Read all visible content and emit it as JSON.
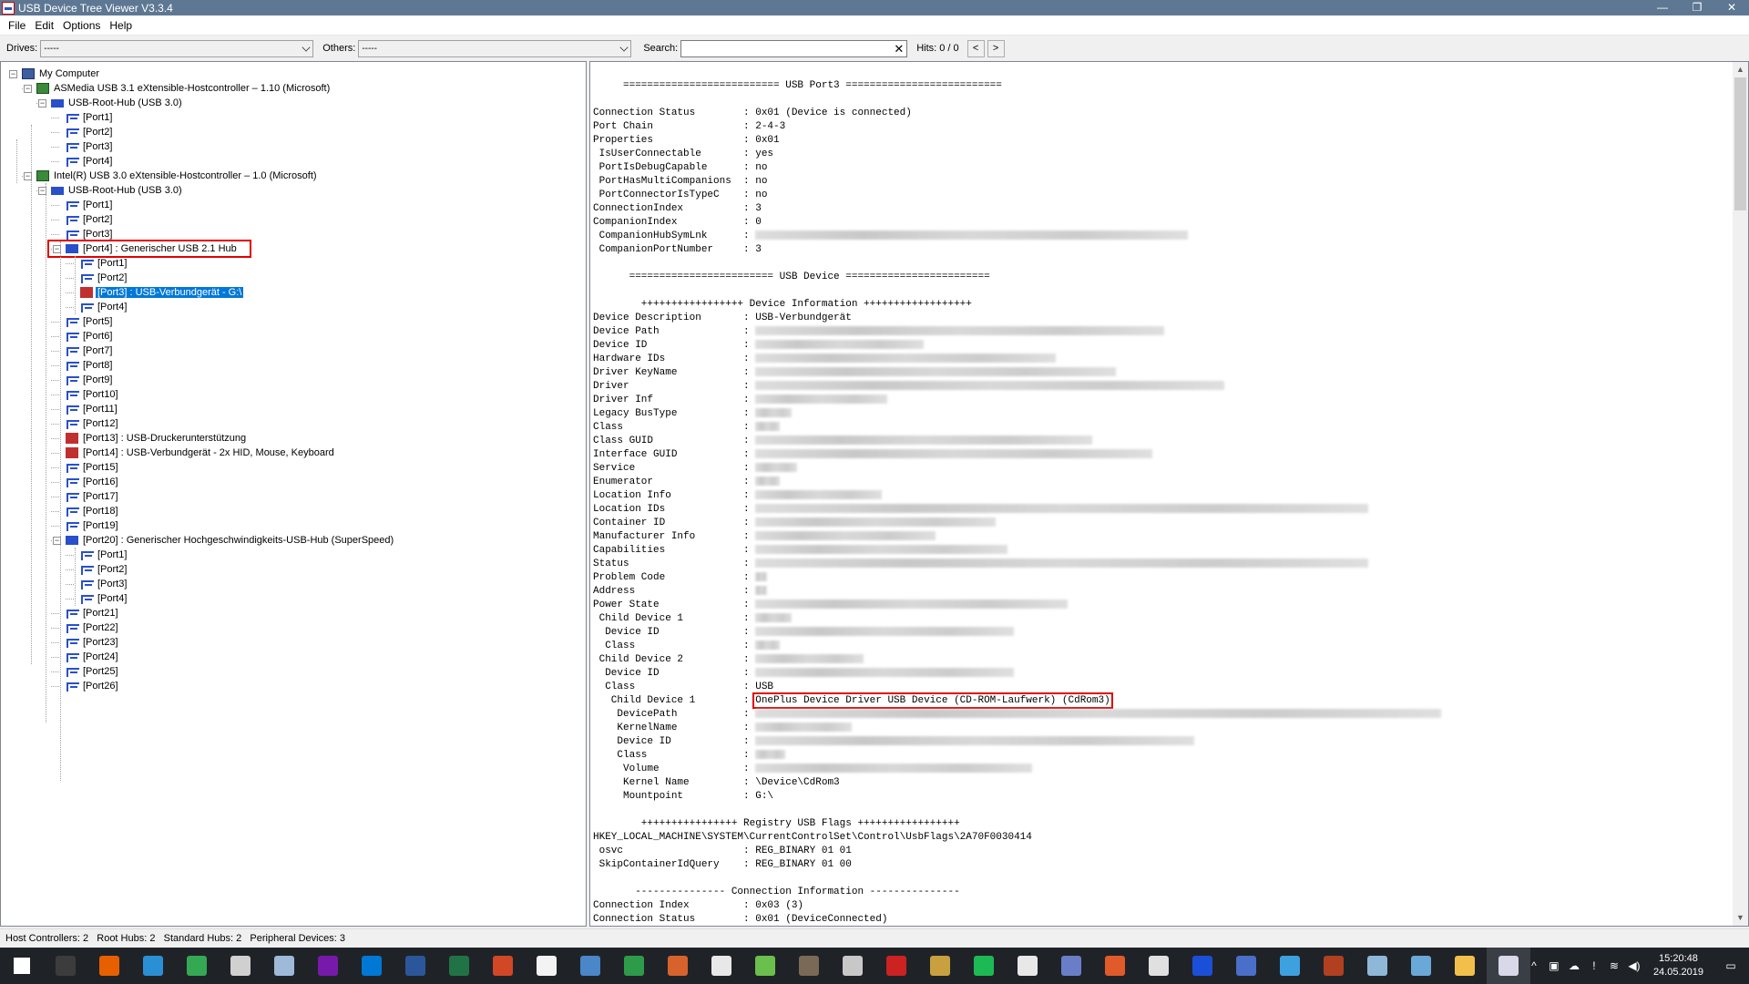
{
  "window": {
    "title": "USB Device Tree Viewer V3.3.4",
    "minimize": "—",
    "restore": "❐",
    "close": "✕"
  },
  "menu": [
    "File",
    "Edit",
    "Options",
    "Help"
  ],
  "toolbar": {
    "drives_label": "Drives:",
    "drives_value": "-----",
    "others_label": "Others:",
    "others_value": "-----",
    "search_label": "Search:",
    "search_value": "",
    "search_clear": "✕",
    "hits_label": "Hits:",
    "hits_value": "0 / 0",
    "prev": "<",
    "next": ">"
  },
  "tree": [
    {
      "label": "My Computer",
      "level": 0,
      "icon": "pc-icon",
      "expander": "−"
    },
    {
      "label": "ASMedia USB 3.1 eXtensible-Hostcontroller – 1.10 (Microsoft)",
      "level": 1,
      "icon": "controller-icon",
      "expander": "−"
    },
    {
      "label": "USB-Root-Hub (USB 3.0)",
      "level": 2,
      "icon": "root-hub-icon",
      "expander": "−"
    },
    {
      "label": "[Port1]",
      "level": 3,
      "icon": "port-icon"
    },
    {
      "label": "[Port2]",
      "level": 3,
      "icon": "port-icon"
    },
    {
      "label": "[Port3]",
      "level": 3,
      "icon": "port-icon"
    },
    {
      "label": "[Port4]",
      "level": 3,
      "icon": "port-icon"
    },
    {
      "label": "Intel(R) USB 3.0 eXtensible-Hostcontroller – 1.0 (Microsoft)",
      "level": 1,
      "icon": "controller-icon",
      "expander": "−"
    },
    {
      "label": "USB-Root-Hub (USB 3.0)",
      "level": 2,
      "icon": "root-hub-icon",
      "expander": "−"
    },
    {
      "label": "[Port1]",
      "level": 3,
      "icon": "port-icon"
    },
    {
      "label": "[Port2]",
      "level": 3,
      "icon": "port-icon"
    },
    {
      "label": "[Port3]",
      "level": 3,
      "icon": "port-icon"
    },
    {
      "label": "[Port4] : Generischer USB 2.1 Hub",
      "level": 3,
      "icon": "hub-icon",
      "expander": "−",
      "boxed": true
    },
    {
      "label": "[Port1]",
      "level": 4,
      "icon": "port-icon"
    },
    {
      "label": "[Port2]",
      "level": 4,
      "icon": "port-icon"
    },
    {
      "label": "[Port3] : USB-Verbundgerät - G:\\",
      "level": 4,
      "icon": "device-icon",
      "selected": true
    },
    {
      "label": "[Port4]",
      "level": 4,
      "icon": "port-icon"
    },
    {
      "label": "[Port5]",
      "level": 3,
      "icon": "port-icon"
    },
    {
      "label": "[Port6]",
      "level": 3,
      "icon": "port-icon"
    },
    {
      "label": "[Port7]",
      "level": 3,
      "icon": "port-icon"
    },
    {
      "label": "[Port8]",
      "level": 3,
      "icon": "port-icon"
    },
    {
      "label": "[Port9]",
      "level": 3,
      "icon": "port-icon"
    },
    {
      "label": "[Port10]",
      "level": 3,
      "icon": "port-icon"
    },
    {
      "label": "[Port11]",
      "level": 3,
      "icon": "port-icon"
    },
    {
      "label": "[Port12]",
      "level": 3,
      "icon": "port-icon"
    },
    {
      "label": "[Port13] : USB-Druckerunterstützung",
      "level": 3,
      "icon": "device-icon"
    },
    {
      "label": "[Port14] : USB-Verbundgerät - 2x HID, Mouse, Keyboard",
      "level": 3,
      "icon": "device-icon"
    },
    {
      "label": "[Port15]",
      "level": 3,
      "icon": "port-icon"
    },
    {
      "label": "[Port16]",
      "level": 3,
      "icon": "port-icon"
    },
    {
      "label": "[Port17]",
      "level": 3,
      "icon": "port-icon"
    },
    {
      "label": "[Port18]",
      "level": 3,
      "icon": "port-icon"
    },
    {
      "label": "[Port19]",
      "level": 3,
      "icon": "port-icon"
    },
    {
      "label": "[Port20] : Generischer Hochgeschwindigkeits-USB-Hub (SuperSpeed)",
      "level": 3,
      "icon": "hub-icon",
      "expander": "−"
    },
    {
      "label": "[Port1]",
      "level": 4,
      "icon": "port-icon"
    },
    {
      "label": "[Port2]",
      "level": 4,
      "icon": "port-icon"
    },
    {
      "label": "[Port3]",
      "level": 4,
      "icon": "port-icon"
    },
    {
      "label": "[Port4]",
      "level": 4,
      "icon": "port-icon"
    },
    {
      "label": "[Port21]",
      "level": 3,
      "icon": "port-icon"
    },
    {
      "label": "[Port22]",
      "level": 3,
      "icon": "port-icon"
    },
    {
      "label": "[Port23]",
      "level": 3,
      "icon": "port-icon"
    },
    {
      "label": "[Port24]",
      "level": 3,
      "icon": "port-icon"
    },
    {
      "label": "[Port25]",
      "level": 3,
      "icon": "port-icon"
    },
    {
      "label": "[Port26]",
      "level": 3,
      "icon": "port-icon"
    }
  ],
  "details": [
    {
      "t": "     ========================== USB Port3 =========================="
    },
    {
      "t": ""
    },
    {
      "t": "Connection Status        : 0x01 (Device is connected)"
    },
    {
      "t": "Port Chain               : 2-4-3"
    },
    {
      "t": "Properties               : 0x01"
    },
    {
      "t": " IsUserConnectable       : yes"
    },
    {
      "t": " PortIsDebugCapable      : no"
    },
    {
      "t": " PortHasMultiCompanions  : no"
    },
    {
      "t": " PortConnectorIsTypeC    : no"
    },
    {
      "t": "ConnectionIndex          : 3"
    },
    {
      "t": "CompanionIndex           : 0"
    },
    {
      "t": " CompanionHubSymLnk      : ",
      "blur": 72
    },
    {
      "t": " CompanionPortNumber     : 3"
    },
    {
      "t": ""
    },
    {
      "t": "      ======================== USB Device ========================"
    },
    {
      "t": ""
    },
    {
      "t": "        +++++++++++++++++ Device Information ++++++++++++++++++"
    },
    {
      "t": "Device Description       : USB-Verbundgerät"
    },
    {
      "t": "Device Path              : ",
      "blur": 68
    },
    {
      "t": "Device ID                : ",
      "blur": 28
    },
    {
      "t": "Hardware IDs             : ",
      "blur": 50
    },
    {
      "t": "Driver KeyName           : ",
      "blur": 60
    },
    {
      "t": "Driver                   : ",
      "blur": 78
    },
    {
      "t": "Driver Inf               : ",
      "blur": 22
    },
    {
      "t": "Legacy BusType           : ",
      "blur": 6
    },
    {
      "t": "Class                    : ",
      "blur": 4
    },
    {
      "t": "Class GUID               : ",
      "blur": 56
    },
    {
      "t": "Interface GUID           : ",
      "blur": 66
    },
    {
      "t": "Service                  : ",
      "blur": 7
    },
    {
      "t": "Enumerator               : ",
      "blur": 4
    },
    {
      "t": "Location Info            : ",
      "blur": 21
    },
    {
      "t": "Location IDs             : ",
      "blur": 102
    },
    {
      "t": "Container ID             : ",
      "blur": 40
    },
    {
      "t": "Manufacturer Info        : ",
      "blur": 30
    },
    {
      "t": "Capabilities             : ",
      "blur": 42
    },
    {
      "t": "Status                   : ",
      "blur": 102
    },
    {
      "t": "Problem Code             : ",
      "blur": 2
    },
    {
      "t": "Address                  : ",
      "blur": 2
    },
    {
      "t": "Power State              : ",
      "blur": 52
    },
    {
      "t": " Child Device 1          : ",
      "blur": 6
    },
    {
      "t": "  Device ID              : ",
      "blur": 43
    },
    {
      "t": "  Class                  : ",
      "blur": 4
    },
    {
      "t": " Child Device 2          : ",
      "blur": 18
    },
    {
      "t": "  Device ID              : ",
      "blur": 43
    },
    {
      "t": "  Class                  : USB"
    },
    {
      "t": "   Child Device 1        : OnePlus Device Driver USB Device (CD-ROM-Laufwerk) (CdRom3)",
      "boxed": true
    },
    {
      "t": "    DevicePath           : ",
      "blur": 114
    },
    {
      "t": "    KernelName           : ",
      "blur": 16
    },
    {
      "t": "    Device ID            : ",
      "blur": 73
    },
    {
      "t": "    Class                : ",
      "blur": 5
    },
    {
      "t": "     Volume              : ",
      "blur": 46
    },
    {
      "t": "     Kernel Name         : \\Device\\CdRom3"
    },
    {
      "t": "     Mountpoint          : G:\\"
    },
    {
      "t": ""
    },
    {
      "t": "        ++++++++++++++++ Registry USB Flags +++++++++++++++++"
    },
    {
      "t": "HKEY_LOCAL_MACHINE\\SYSTEM\\CurrentControlSet\\Control\\UsbFlags\\2A70F0030414"
    },
    {
      "t": " osvc                    : REG_BINARY 01 01"
    },
    {
      "t": " SkipContainerIdQuery    : REG_BINARY 01 00"
    },
    {
      "t": ""
    },
    {
      "t": "       --------------- Connection Information ---------------"
    },
    {
      "t": "Connection Index         : 0x03 (3)"
    },
    {
      "t": "Connection Status        : 0x01 (DeviceConnected)"
    }
  ],
  "status": "Host Controllers: 2   Root Hubs: 2   Standard Hubs: 2   Peripheral Devices: 3",
  "taskbar": {
    "apps": [
      {
        "name": "start-icon",
        "color": "#ffffff"
      },
      {
        "name": "terminal-icon",
        "color": "#3c3c3c"
      },
      {
        "name": "firefox-icon",
        "color": "#e66000"
      },
      {
        "name": "chat-icon",
        "color": "#2b8fd6"
      },
      {
        "name": "chrome-icon",
        "color": "#34a853"
      },
      {
        "name": "calculator-icon",
        "color": "#d0d0d0"
      },
      {
        "name": "notepad-icon",
        "color": "#9fb9d9"
      },
      {
        "name": "onenote-icon",
        "color": "#7719aa"
      },
      {
        "name": "outlook-icon",
        "color": "#0078d4"
      },
      {
        "name": "word-icon",
        "color": "#2b579a"
      },
      {
        "name": "excel-icon",
        "color": "#217346"
      },
      {
        "name": "powerpoint-icon",
        "color": "#d24726"
      },
      {
        "name": "file-icon",
        "color": "#f3f3f3"
      },
      {
        "name": "document-icon",
        "color": "#4a86c8"
      },
      {
        "name": "spreadsheet-icon",
        "color": "#2e9b4a"
      },
      {
        "name": "presentation-icon",
        "color": "#d8622c"
      },
      {
        "name": "pdf-icon",
        "color": "#e8e8e8"
      },
      {
        "name": "chart-file-icon",
        "color": "#6bbf4c"
      },
      {
        "name": "gimp-icon",
        "color": "#7a6a55"
      },
      {
        "name": "steam-icon",
        "color": "#c8c8c8"
      },
      {
        "name": "terminal-red-icon",
        "color": "#cc2222"
      },
      {
        "name": "winamp-icon",
        "color": "#c8a040"
      },
      {
        "name": "spotify-icon",
        "color": "#1db954"
      },
      {
        "name": "cloud-icon",
        "color": "#e8e8e8"
      },
      {
        "name": "paint-icon",
        "color": "#6a7ec8"
      },
      {
        "name": "check-icon",
        "color": "#e05a2a"
      },
      {
        "name": "eac-icon",
        "color": "#e0e0e0"
      },
      {
        "name": "chromium-icon",
        "color": "#1c4fd8"
      },
      {
        "name": "film-icon",
        "color": "#4a6fc8"
      },
      {
        "name": "visual-studio-icon",
        "color": "#3da1e0"
      },
      {
        "name": "mediaplayer-icon",
        "color": "#b04020"
      },
      {
        "name": "virtualbox-icon",
        "color": "#8fb8d8"
      },
      {
        "name": "window-icon",
        "color": "#6aa8d8"
      },
      {
        "name": "explorer-icon",
        "color": "#f2c04a"
      },
      {
        "name": "usbtreeview-icon",
        "color": "#d8d8e8"
      }
    ],
    "time": "15:20:48",
    "date": "24.05.2019"
  }
}
